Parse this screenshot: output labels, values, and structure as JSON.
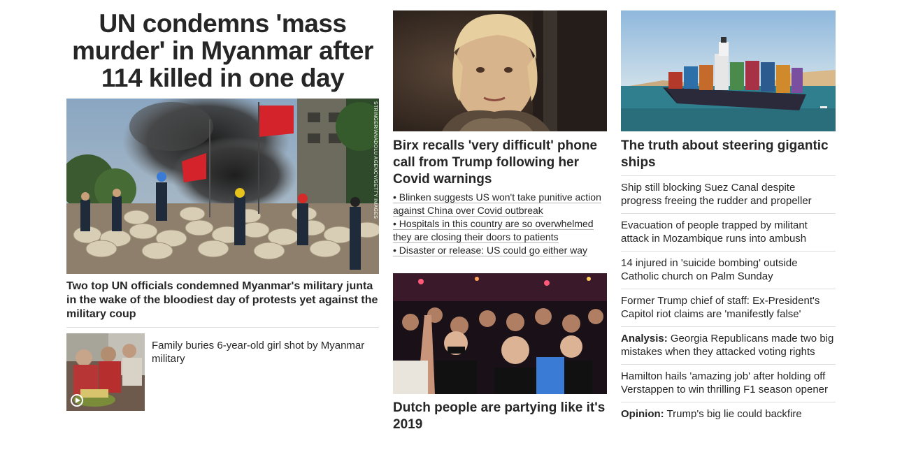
{
  "lead": {
    "headline": "UN condemns 'mass murder' in Myanmar after 114 killed in one day",
    "photo_credit": "STRINGER/ANADOLU AGENCY/GETTY IMAGES",
    "caption": "Two top UN officials condemned Myanmar's military junta in the wake of the bloodiest day of protests yet against the military coup"
  },
  "small_story": {
    "title": "Family buries 6-year-old girl shot by Myanmar military"
  },
  "birx": {
    "headline": "Birx recalls 'very difficult' phone call from Trump following her Covid warnings",
    "bullets": [
      "• Blinken suggests US won't take punitive action against China over Covid outbreak",
      "• Hospitals in this country are so overwhelmed they are closing their doors to patients",
      "• Disaster or release: US could go either way"
    ]
  },
  "dutch": {
    "headline": "Dutch people are partying like it's 2019"
  },
  "ships": {
    "headline": "The truth about steering gigantic ships",
    "items": [
      {
        "prefix": "",
        "text": "Ship still blocking Suez Canal despite progress freeing the rudder and propeller"
      },
      {
        "prefix": "",
        "text": "Evacuation of people trapped by militant attack in Mozambique runs into ambush"
      },
      {
        "prefix": "",
        "text": "14 injured in 'suicide bombing' outside Catholic church on Palm Sunday"
      },
      {
        "prefix": "",
        "text": "Former Trump chief of staff: Ex-President's Capitol riot claims are 'manifestly false'"
      },
      {
        "prefix": "Analysis:",
        "text": " Georgia Republicans made two big mistakes when they attacked voting rights"
      },
      {
        "prefix": "",
        "text": "Hamilton hails 'amazing job' after holding off Verstappen to win thrilling F1 season opener"
      },
      {
        "prefix": "Opinion:",
        "text": " Trump's big lie could backfire"
      }
    ]
  }
}
